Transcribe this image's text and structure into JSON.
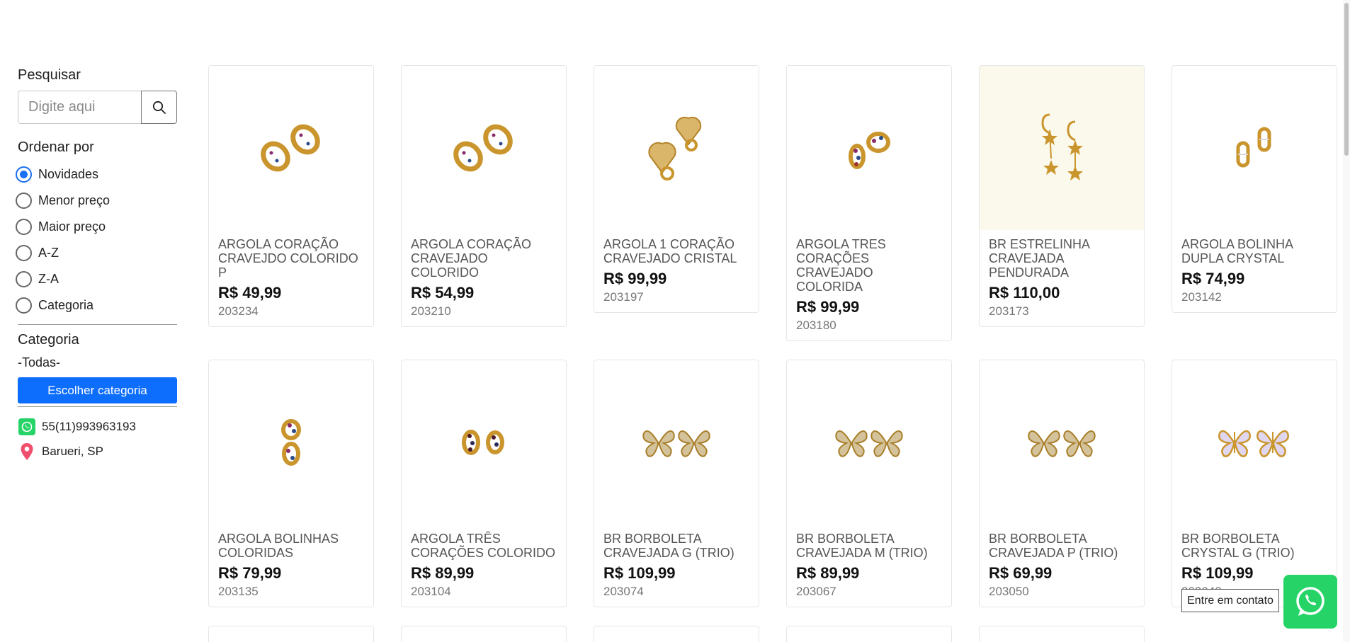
{
  "search": {
    "title": "Pesquisar",
    "placeholder": "Digite aqui"
  },
  "sort": {
    "title": "Ordenar por",
    "options": [
      "Novidades",
      "Menor preço",
      "Maior preço",
      "A-Z",
      "Z-A",
      "Categoria"
    ],
    "selected": "Novidades"
  },
  "category": {
    "title": "Categoria",
    "value": "-Todas-",
    "button_label": "Escolher categoria"
  },
  "contact": {
    "phone": "55(11)993963193",
    "location": "Barueri, SP"
  },
  "products": [
    {
      "title": "ARGOLA CORAÇÃO CRAVEJDO COLORIDO P",
      "price": "R$ 49,99",
      "code": "203234",
      "image": "heart-hoop-earrings-colored"
    },
    {
      "title": "ARGOLA CORAÇÃO CRAVEJADO COLORIDO",
      "price": "R$ 54,99",
      "code": "203210",
      "image": "heart-hoop-earrings-colored"
    },
    {
      "title": "ARGOLA 1 CORAÇÃO CRAVEJADO CRISTAL",
      "price": "R$ 99,99",
      "code": "203197",
      "image": "heart-hoop-earrings-crystal"
    },
    {
      "title": "ARGOLA TRES CORAÇÕES CRAVEJADO COLORIDA",
      "price": "R$ 99,99",
      "code": "203180",
      "image": "three-hearts-hoop-earrings"
    },
    {
      "title": "BR ESTRELINHA CRAVEJADA PENDURADA",
      "price": "R$ 110,00",
      "code": "203173",
      "image": "star-dangle-earrings"
    },
    {
      "title": "ARGOLA BOLINHA DUPLA CRYSTAL",
      "price": "R$ 74,99",
      "code": "203142",
      "image": "double-ball-hoop-earrings"
    },
    {
      "title": "ARGOLA BOLINHAS COLORIDAS",
      "price": "R$ 79,99",
      "code": "203135",
      "image": "colored-ball-hoop-earrings"
    },
    {
      "title": "ARGOLA TRÊS CORAÇÕES COLORIDO",
      "price": "R$ 89,99",
      "code": "203104",
      "image": "three-hearts-colored-hoops"
    },
    {
      "title": "BR BORBOLETA CRAVEJADA G (TRIO)",
      "price": "R$ 109,99",
      "code": "203074",
      "image": "butterfly-stud-earrings"
    },
    {
      "title": "BR BORBOLETA CRAVEJADA M (TRIO)",
      "price": "R$ 89,99",
      "code": "203067",
      "image": "butterfly-stud-earrings"
    },
    {
      "title": "BR BORBOLETA CRAVEJADA P (TRIO)",
      "price": "R$ 69,99",
      "code": "203050",
      "image": "butterfly-stud-earrings"
    },
    {
      "title": "BR BORBOLETA CRYSTAL G (TRIO)",
      "price": "R$ 109,99",
      "code": "203043",
      "image": "butterfly-crystal-earrings"
    }
  ],
  "whatsapp": {
    "tooltip": "Entre em contato"
  },
  "colors": {
    "accent": "#0d6efd",
    "whatsapp": "#25d366",
    "gold": "#c9952c"
  }
}
